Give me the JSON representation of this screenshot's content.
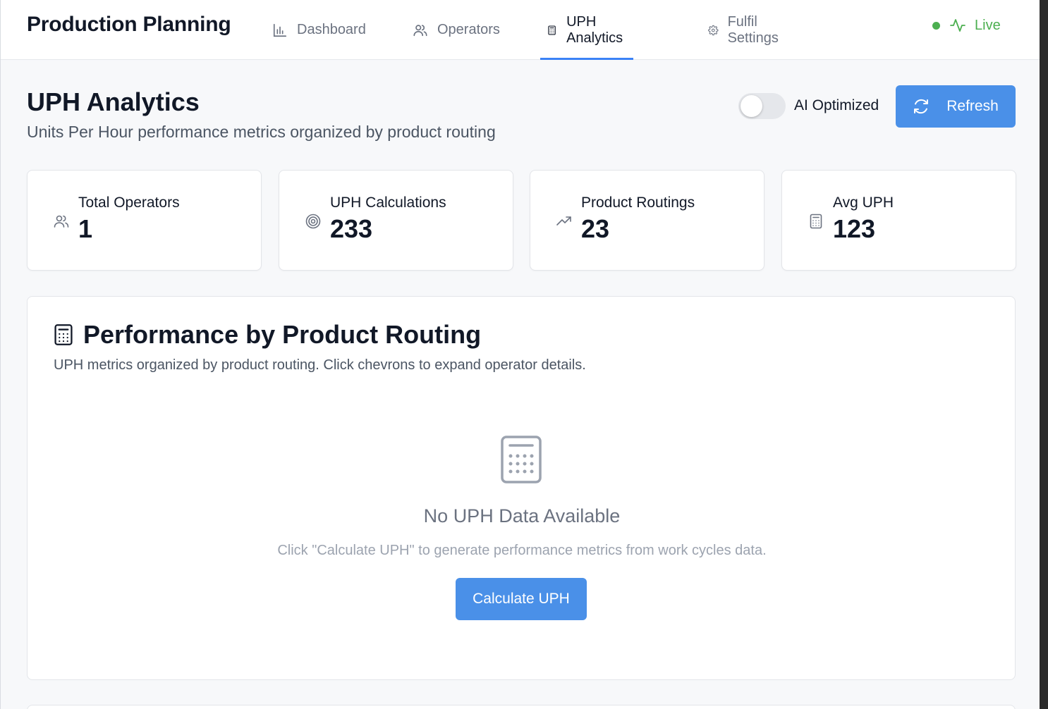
{
  "app": {
    "title": "Production Planning"
  },
  "nav": {
    "items": [
      {
        "label": "Dashboard",
        "icon": "bar-chart-icon",
        "active": false
      },
      {
        "label": "Operators",
        "icon": "users-icon",
        "active": false
      },
      {
        "label": "UPH Analytics",
        "icon": "calculator-icon",
        "active": true
      },
      {
        "label": "Fulfil Settings",
        "icon": "gear-icon",
        "active": false
      }
    ]
  },
  "status": {
    "label": "Live",
    "color": "#4caf50",
    "icon": "activity-icon"
  },
  "page": {
    "title": "UPH Analytics",
    "subtitle": "Units Per Hour performance metrics organized by product routing"
  },
  "controls": {
    "toggle_label": "AI Optimized",
    "toggle_on": false,
    "refresh_label": "Refresh"
  },
  "stats": [
    {
      "label": "Total Operators",
      "value": "1",
      "icon": "users-icon"
    },
    {
      "label": "UPH Calculations",
      "value": "233",
      "icon": "target-icon"
    },
    {
      "label": "Product Routings",
      "value": "23",
      "icon": "trending-up-icon"
    },
    {
      "label": "Avg UPH",
      "value": "123",
      "icon": "calculator-icon"
    }
  ],
  "performance": {
    "title": "Performance by Product Routing",
    "description": "UPH metrics organized by product routing. Click chevrons to expand operator details.",
    "empty_title": "No UPH Data Available",
    "empty_description": "Click \"Calculate UPH\" to generate performance metrics from work cycles data.",
    "calculate_label": "Calculate UPH"
  },
  "colors": {
    "accent": "#4a90e8",
    "active_tab_underline": "#3b82f6"
  }
}
